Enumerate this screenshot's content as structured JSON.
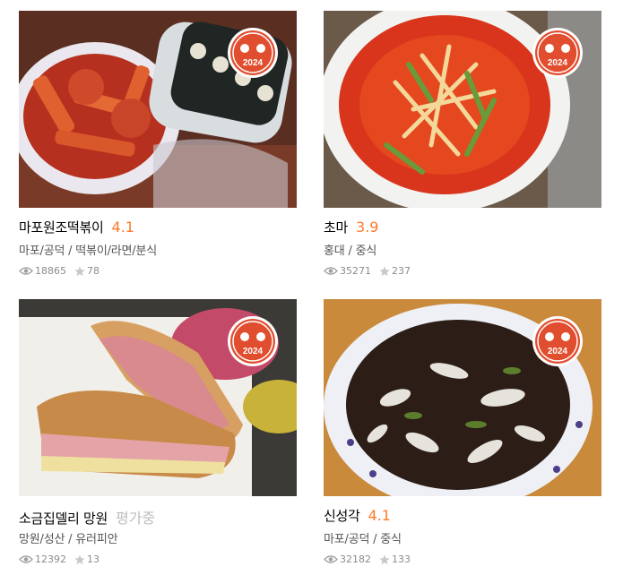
{
  "badge": {
    "year": "2024",
    "color": "#e14e2f"
  },
  "restaurants": [
    {
      "name": "마포원조떡볶이",
      "rating": "4.1",
      "rating_pending": false,
      "location": "마포/공덕",
      "category": "떡볶이/라면/분식",
      "views": "18865",
      "reviews": "78",
      "image": "tteokbokki-with-gimbap"
    },
    {
      "name": "초마",
      "rating": "3.9",
      "rating_pending": false,
      "location": "홍대",
      "category": "중식",
      "views": "35271",
      "reviews": "237",
      "image": "jjamppong-noodle-soup"
    },
    {
      "name": "소금집델리 망원",
      "rating": "평가중",
      "rating_pending": true,
      "location": "망원/성산",
      "category": "유러피안",
      "views": "12392",
      "reviews": "13",
      "image": "pastrami-sandwich"
    },
    {
      "name": "신성각",
      "rating": "4.1",
      "rating_pending": false,
      "location": "마포/공덕",
      "category": "중식",
      "views": "32182",
      "reviews": "133",
      "image": "jajang-sauce-with-onions"
    }
  ]
}
